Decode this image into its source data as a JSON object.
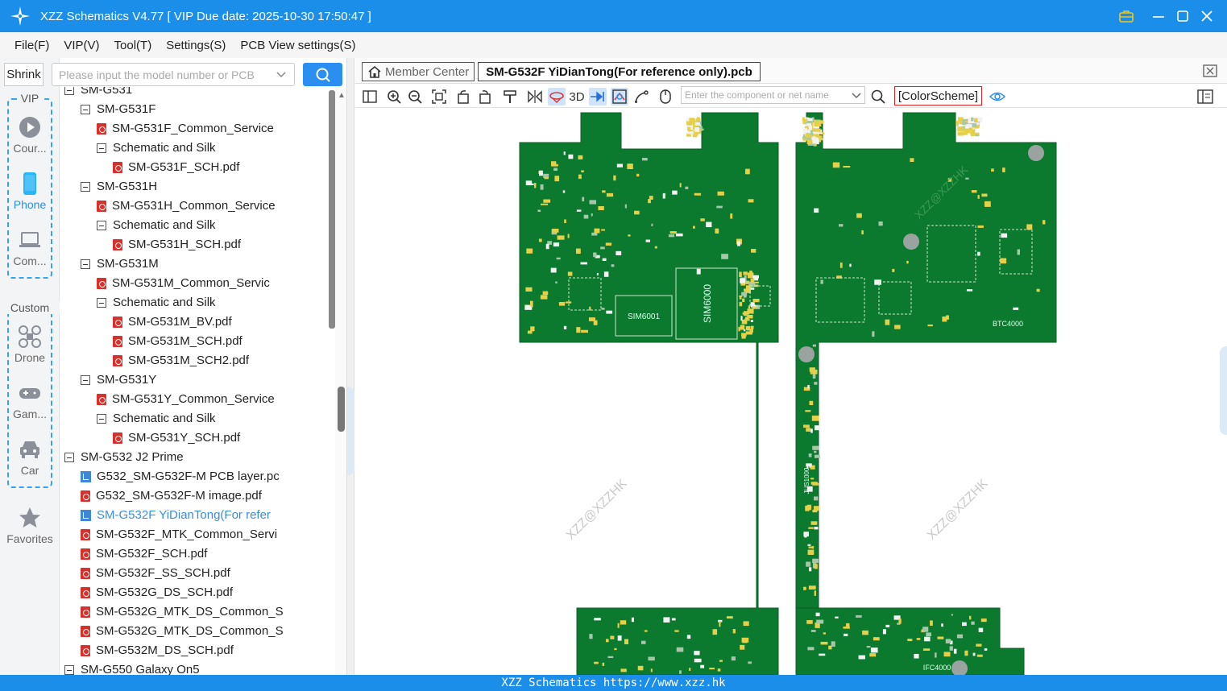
{
  "window": {
    "title": "XZZ Schematics V4.77 [ VIP Due date: 2025-10-30 17:50:47 ]"
  },
  "menu": [
    "File(F)",
    "VIP(V)",
    "Tool(T)",
    "Settings(S)",
    "PCB View settings(S)"
  ],
  "search": {
    "shrink_label": "Shrink",
    "placeholder": "Please input the model number or PCB"
  },
  "rail": {
    "vip_label": "VIP",
    "custom_label": "Custom",
    "items": [
      {
        "label": "Cour...",
        "icon": "play-icon"
      },
      {
        "label": "Phone",
        "icon": "phone-icon"
      },
      {
        "label": "Com...",
        "icon": "laptop-icon"
      },
      {
        "label": "Drone",
        "icon": "drone-icon"
      },
      {
        "label": "Gam...",
        "icon": "gamepad-icon"
      },
      {
        "label": "Car",
        "icon": "car-icon"
      },
      {
        "label": "Favorites",
        "icon": "star-icon"
      }
    ]
  },
  "tree": [
    {
      "label": "SM-G531",
      "indent": 1,
      "type": "folder"
    },
    {
      "label": "SM-G531F",
      "indent": 2,
      "type": "folder"
    },
    {
      "label": "SM-G531F_Common_Service",
      "indent": 3,
      "type": "pdf"
    },
    {
      "label": "Schematic and Silk",
      "indent": 3,
      "type": "folder"
    },
    {
      "label": "SM-G531F_SCH.pdf",
      "indent": 4,
      "type": "pdf"
    },
    {
      "label": "SM-G531H",
      "indent": 2,
      "type": "folder"
    },
    {
      "label": "SM-G531H_Common_Service",
      "indent": 3,
      "type": "pdf"
    },
    {
      "label": "Schematic and Silk",
      "indent": 3,
      "type": "folder"
    },
    {
      "label": "SM-G531H_SCH.pdf",
      "indent": 4,
      "type": "pdf"
    },
    {
      "label": "SM-G531M",
      "indent": 2,
      "type": "folder"
    },
    {
      "label": "SM-G531M_Common_Servic",
      "indent": 3,
      "type": "pdf"
    },
    {
      "label": "Schematic and Silk",
      "indent": 3,
      "type": "folder"
    },
    {
      "label": "SM-G531M_BV.pdf",
      "indent": 4,
      "type": "pdf"
    },
    {
      "label": "SM-G531M_SCH.pdf",
      "indent": 4,
      "type": "pdf"
    },
    {
      "label": "SM-G531M_SCH2.pdf",
      "indent": 4,
      "type": "pdf"
    },
    {
      "label": "SM-G531Y",
      "indent": 2,
      "type": "folder"
    },
    {
      "label": "SM-G531Y_Common_Service",
      "indent": 3,
      "type": "pdf"
    },
    {
      "label": "Schematic and Silk",
      "indent": 3,
      "type": "folder"
    },
    {
      "label": "SM-G531Y_SCH.pdf",
      "indent": 4,
      "type": "pdf"
    },
    {
      "label": "SM-G532 J2 Prime",
      "indent": 1,
      "type": "folder"
    },
    {
      "label": "G532_SM-G532F-M PCB layer.pc",
      "indent": 2,
      "type": "pcb"
    },
    {
      "label": "G532_SM-G532F-M image.pdf",
      "indent": 2,
      "type": "pdf"
    },
    {
      "label": "SM-G532F YiDianTong(For refer",
      "indent": 2,
      "type": "pcb",
      "selected": true
    },
    {
      "label": "SM-G532F_MTK_Common_Servi",
      "indent": 2,
      "type": "pdf"
    },
    {
      "label": "SM-G532F_SCH.pdf",
      "indent": 2,
      "type": "pdf"
    },
    {
      "label": "SM-G532F_SS_SCH.pdf",
      "indent": 2,
      "type": "pdf"
    },
    {
      "label": "SM-G532G_DS_SCH.pdf",
      "indent": 2,
      "type": "pdf"
    },
    {
      "label": "SM-G532G_MTK_DS_Common_S",
      "indent": 2,
      "type": "pdf"
    },
    {
      "label": "SM-G532G_MTK_DS_Common_S",
      "indent": 2,
      "type": "pdf"
    },
    {
      "label": "SM-G532M_DS_SCH.pdf",
      "indent": 2,
      "type": "pdf"
    },
    {
      "label": "SM-G550 Galaxy On5",
      "indent": 1,
      "type": "folder"
    }
  ],
  "tabs": {
    "member_center": "Member Center",
    "active_file": "SM-G532F YiDianTong(For reference only).pcb"
  },
  "toolbar": {
    "label_3d": "3D",
    "component_placeholder": "Enter the component or net name",
    "color_scheme": "[ColorScheme]"
  },
  "pcb": {
    "labels": [
      "SIM6001",
      "SIM6000",
      "BTC4000",
      "IFC4000",
      "JUS1000"
    ],
    "watermark": "XZZ@XZZHK",
    "board_color": "#0b7a2e"
  },
  "status": "XZZ Schematics https://www.xzz.hk",
  "colors": {
    "accent": "#1a8ee8",
    "selected_text": "#3a8de0",
    "pdf_red": "#d9302c"
  }
}
